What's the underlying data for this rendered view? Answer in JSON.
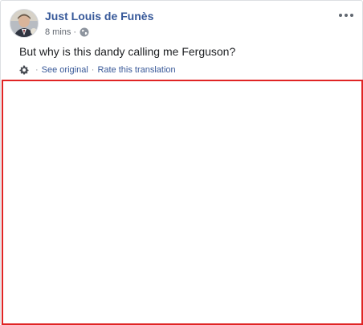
{
  "post": {
    "author": "Just Louis de Funès",
    "time": "8 mins",
    "separator": "·",
    "text": "But why is this dandy calling me Ferguson?",
    "translation": {
      "see_original": "See original",
      "separator": "·",
      "rate": "Rate this translation"
    }
  },
  "icons": {
    "avatar": "profile-photo",
    "privacy": "globe-icon",
    "settings": "gear-icon",
    "more": "more-options-icon"
  },
  "colors": {
    "author_link": "#365899",
    "translation_link": "#385898",
    "highlight_border": "#e02424"
  }
}
